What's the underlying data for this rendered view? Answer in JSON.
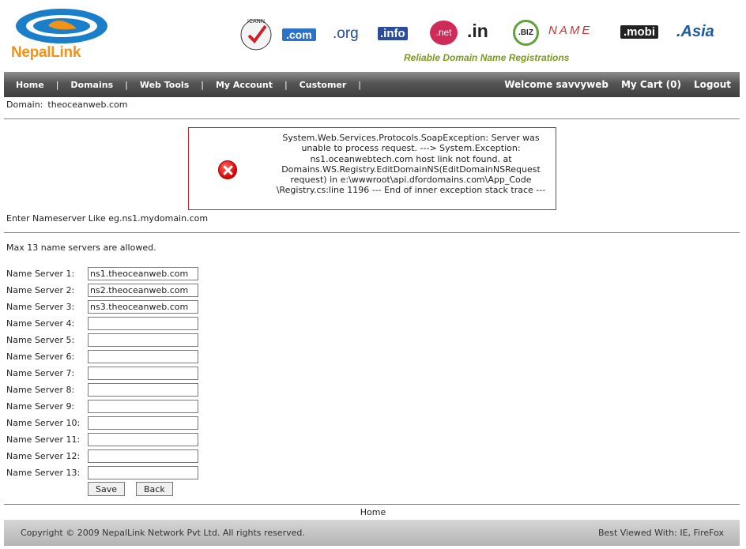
{
  "brand": {
    "name": "NepalLink",
    "tagline": "Reliable Domain Name Registrations"
  },
  "tld_logos": [
    {
      "name": "icann-accredited-registrar-logo",
      "text": "ICANN"
    },
    {
      "name": "com-logo",
      "text": ".com"
    },
    {
      "name": "org-logo",
      "text": ".org"
    },
    {
      "name": "info-logo",
      "text": ".info"
    },
    {
      "name": "net-logo",
      "text": ".net"
    },
    {
      "name": "in-logo",
      "text": ".in"
    },
    {
      "name": "biz-logo",
      "text": ".BIZ"
    },
    {
      "name": "name-logo",
      "text": "NAME"
    },
    {
      "name": "mobi-logo",
      "text": ".mobi"
    },
    {
      "name": "asia-logo",
      "text": ".Asia"
    }
  ],
  "nav": {
    "items": [
      "Home",
      "Domains",
      "Web Tools",
      "My Account",
      "Customer"
    ],
    "welcome": "Welcome savvyweb",
    "cart": "My Cart (0)",
    "logout": "Logout"
  },
  "domain": {
    "label": "Domain:",
    "value": "theoceanweb.com"
  },
  "error": {
    "message": "System.Web.Services.Protocols.SoapException: Server was unable to process request. ---> System.Exception: ns1.oceanwebtech.com host link not found. at Domains.WS.Registry.EditDomainNS(EditDomainNSRequest request) in e:\\wwwroot\\api.dfordomains.com\\App_Code \\Registry.cs:line 1196 --- End of inner exception stack trace ---"
  },
  "hint": "Enter Nameserver Like eg.ns1.mydomain.com",
  "max_note": "Max 13 name servers are allowed.",
  "name_servers": [
    {
      "label": "Name Server 1:",
      "value": "ns1.theoceanweb.com"
    },
    {
      "label": "Name Server 2:",
      "value": "ns2.theoceanweb.com"
    },
    {
      "label": "Name Server 3:",
      "value": "ns3.theoceanweb.com"
    },
    {
      "label": "Name Server 4:",
      "value": ""
    },
    {
      "label": "Name Server 5:",
      "value": ""
    },
    {
      "label": "Name Server 6:",
      "value": ""
    },
    {
      "label": "Name Server 7:",
      "value": ""
    },
    {
      "label": "Name Server 8:",
      "value": ""
    },
    {
      "label": "Name Server 9:",
      "value": ""
    },
    {
      "label": "Name Server 10:",
      "value": ""
    },
    {
      "label": "Name Server 11:",
      "value": ""
    },
    {
      "label": "Name Server 12:",
      "value": ""
    },
    {
      "label": "Name Server 13:",
      "value": ""
    }
  ],
  "buttons": {
    "save": "Save",
    "back": "Back"
  },
  "footer": {
    "home_link": "Home",
    "copyright": "Copyright © 2009 NepalLink Network Pvt Ltd. All rights reserved.",
    "best_viewed": "Best Viewed With: IE, FireFox"
  }
}
